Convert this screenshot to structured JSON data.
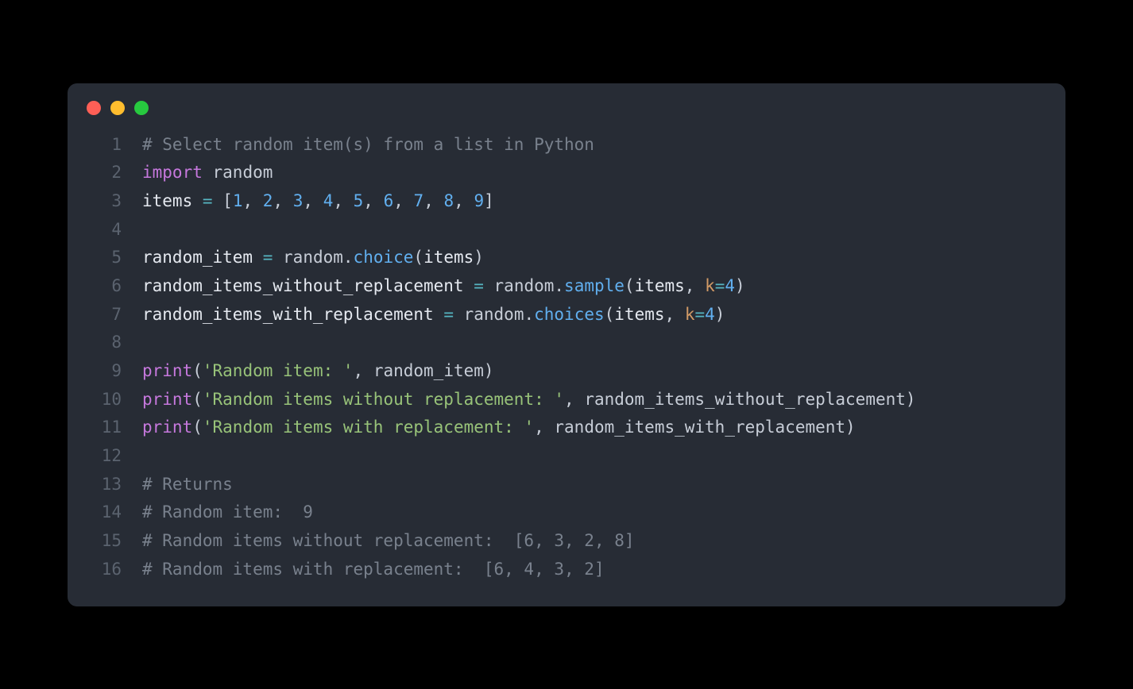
{
  "window": {
    "dots": [
      "red",
      "yellow",
      "green"
    ]
  },
  "lines": [
    {
      "n": "1",
      "tokens": [
        {
          "c": "cmt",
          "t": "# Select random item(s) from a list in Python"
        }
      ]
    },
    {
      "n": "2",
      "tokens": [
        {
          "c": "kw",
          "t": "import"
        },
        {
          "c": "code",
          "t": " "
        },
        {
          "c": "lib",
          "t": "random"
        }
      ]
    },
    {
      "n": "3",
      "tokens": [
        {
          "c": "var",
          "t": "items"
        },
        {
          "c": "code",
          "t": " "
        },
        {
          "c": "op",
          "t": "="
        },
        {
          "c": "code",
          "t": " ["
        },
        {
          "c": "num",
          "t": "1"
        },
        {
          "c": "code",
          "t": ", "
        },
        {
          "c": "num",
          "t": "2"
        },
        {
          "c": "code",
          "t": ", "
        },
        {
          "c": "num",
          "t": "3"
        },
        {
          "c": "code",
          "t": ", "
        },
        {
          "c": "num",
          "t": "4"
        },
        {
          "c": "code",
          "t": ", "
        },
        {
          "c": "num",
          "t": "5"
        },
        {
          "c": "code",
          "t": ", "
        },
        {
          "c": "num",
          "t": "6"
        },
        {
          "c": "code",
          "t": ", "
        },
        {
          "c": "num",
          "t": "7"
        },
        {
          "c": "code",
          "t": ", "
        },
        {
          "c": "num",
          "t": "8"
        },
        {
          "c": "code",
          "t": ", "
        },
        {
          "c": "num",
          "t": "9"
        },
        {
          "c": "code",
          "t": "]"
        }
      ]
    },
    {
      "n": "4",
      "tokens": []
    },
    {
      "n": "5",
      "tokens": [
        {
          "c": "var",
          "t": "random_item"
        },
        {
          "c": "code",
          "t": " "
        },
        {
          "c": "op",
          "t": "="
        },
        {
          "c": "code",
          "t": " random."
        },
        {
          "c": "fn",
          "t": "choice"
        },
        {
          "c": "paren",
          "t": "("
        },
        {
          "c": "var",
          "t": "items"
        },
        {
          "c": "paren",
          "t": ")"
        }
      ]
    },
    {
      "n": "6",
      "tokens": [
        {
          "c": "var",
          "t": "random_items_without_replacement"
        },
        {
          "c": "code",
          "t": " "
        },
        {
          "c": "op",
          "t": "="
        },
        {
          "c": "code",
          "t": " random."
        },
        {
          "c": "fn",
          "t": "sample"
        },
        {
          "c": "paren",
          "t": "("
        },
        {
          "c": "var",
          "t": "items"
        },
        {
          "c": "code",
          "t": ", "
        },
        {
          "c": "karg",
          "t": "k"
        },
        {
          "c": "op",
          "t": "="
        },
        {
          "c": "num",
          "t": "4"
        },
        {
          "c": "paren",
          "t": ")"
        }
      ]
    },
    {
      "n": "7",
      "tokens": [
        {
          "c": "var",
          "t": "random_items_with_replacement"
        },
        {
          "c": "code",
          "t": " "
        },
        {
          "c": "op",
          "t": "="
        },
        {
          "c": "code",
          "t": " random."
        },
        {
          "c": "fn",
          "t": "choices"
        },
        {
          "c": "paren",
          "t": "("
        },
        {
          "c": "var",
          "t": "items"
        },
        {
          "c": "code",
          "t": ", "
        },
        {
          "c": "karg",
          "t": "k"
        },
        {
          "c": "op",
          "t": "="
        },
        {
          "c": "num",
          "t": "4"
        },
        {
          "c": "paren",
          "t": ")"
        }
      ]
    },
    {
      "n": "8",
      "tokens": []
    },
    {
      "n": "9",
      "tokens": [
        {
          "c": "builtin",
          "t": "print"
        },
        {
          "c": "paren",
          "t": "("
        },
        {
          "c": "str",
          "t": "'Random item: '"
        },
        {
          "c": "code",
          "t": ", random_item"
        },
        {
          "c": "paren",
          "t": ")"
        }
      ]
    },
    {
      "n": "10",
      "tokens": [
        {
          "c": "builtin",
          "t": "print"
        },
        {
          "c": "paren",
          "t": "("
        },
        {
          "c": "str",
          "t": "'Random items without replacement: '"
        },
        {
          "c": "code",
          "t": ", random_items_without_replacement"
        },
        {
          "c": "paren",
          "t": ")"
        }
      ]
    },
    {
      "n": "11",
      "tokens": [
        {
          "c": "builtin",
          "t": "print"
        },
        {
          "c": "paren",
          "t": "("
        },
        {
          "c": "str",
          "t": "'Random items with replacement: '"
        },
        {
          "c": "code",
          "t": ", random_items_with_replacement"
        },
        {
          "c": "paren",
          "t": ")"
        }
      ]
    },
    {
      "n": "12",
      "tokens": []
    },
    {
      "n": "13",
      "tokens": [
        {
          "c": "cmt",
          "t": "# Returns"
        }
      ]
    },
    {
      "n": "14",
      "tokens": [
        {
          "c": "cmt",
          "t": "# Random item:  9"
        }
      ]
    },
    {
      "n": "15",
      "tokens": [
        {
          "c": "cmt",
          "t": "# Random items without replacement:  [6, 3, 2, 8]"
        }
      ]
    },
    {
      "n": "16",
      "tokens": [
        {
          "c": "cmt",
          "t": "# Random items with replacement:  [6, 4, 3, 2]"
        }
      ]
    }
  ]
}
